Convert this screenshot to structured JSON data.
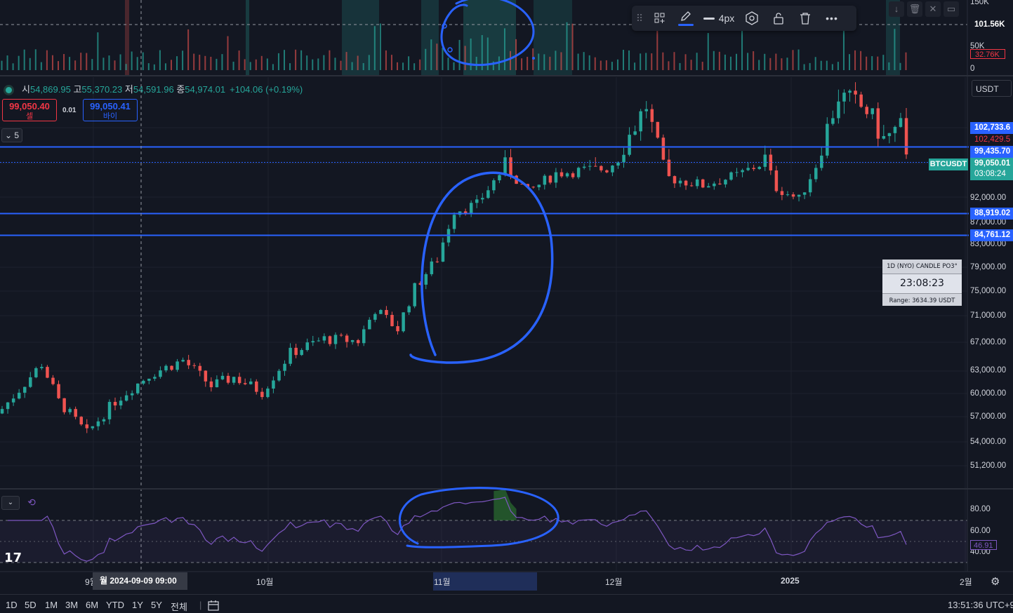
{
  "legend": {
    "open_label": "시",
    "open": "54,869.95",
    "high_label": "고",
    "high": "55,370.23",
    "low_label": "저",
    "low": "54,591.96",
    "close_label": "종",
    "close": "54,974.01",
    "change": "+104.06 (+0.19%)"
  },
  "trade": {
    "sell_price": "99,050.40",
    "sell_label": "셀",
    "spread": "0.01",
    "buy_price": "99,050.41",
    "buy_label": "바이"
  },
  "collapse_count": "5",
  "toolbar": {
    "width_label": "4px"
  },
  "currency": "USDT",
  "volume_axis": {
    "labels": [
      "150K",
      "101.56K",
      "50K",
      "32.76K",
      "0"
    ]
  },
  "price_axis_labels": [
    "92,000.00",
    "87,000.00",
    "83,000.00",
    "79,000.00",
    "75,000.00",
    "71,000.00",
    "67,000.00",
    "63,000.00",
    "60,000.00",
    "57,000.00",
    "54,000.00",
    "51,200.00"
  ],
  "price_tags": {
    "high": "102,733.6",
    "current_red": "102,429.5",
    "line1": "99,435.70",
    "last": "99,050.01",
    "countdown": "03:08:24",
    "line2": "88,919.02",
    "line3": "84,761.12"
  },
  "symbol_tag": "BTCUSDT",
  "timer_card": {
    "title": "1D (NYO) CANDLE PO3°",
    "time": "23:08:23",
    "range": "Range: 3634.39 USDT"
  },
  "rsi": {
    "axis_labels": [
      "80.00",
      "60.00",
      "40.00"
    ],
    "value": "46.91"
  },
  "x_axis": {
    "sep": "9월",
    "crosshair_date": "월 2024-09-09   09:00",
    "oct": "10월",
    "nov": "11월",
    "dec": "12월",
    "y2025": "2025",
    "feb": "2월"
  },
  "bottom_bar": {
    "ranges": [
      "1D",
      "5D",
      "1M",
      "3M",
      "6M",
      "YTD",
      "1Y",
      "5Y",
      "전체"
    ],
    "clock": "13:51:36 UTC+9"
  },
  "colors": {
    "up": "#26a69a",
    "down": "#ef5350",
    "hline": "#2962ff",
    "rsi": "#7e57c2",
    "annotation": "#2962ff"
  },
  "chart_data": {
    "type": "candlestick",
    "symbol": "BTCUSDT",
    "interval": "1D",
    "close_path": [
      [
        "2024-08-25",
        58000
      ],
      [
        "2024-08-28",
        60500
      ],
      [
        "2024-09-01",
        64000
      ],
      [
        "2024-09-04",
        59000
      ],
      [
        "2024-09-07",
        56500
      ],
      [
        "2024-09-09",
        54974
      ],
      [
        "2024-09-14",
        59000
      ],
      [
        "2024-09-20",
        62500
      ],
      [
        "2024-09-26",
        64500
      ],
      [
        "2024-10-01",
        61000
      ],
      [
        "2024-10-05",
        62200
      ],
      [
        "2024-10-10",
        60200
      ],
      [
        "2024-10-15",
        65500
      ],
      [
        "2024-10-21",
        67500
      ],
      [
        "2024-10-27",
        67200
      ],
      [
        "2024-10-30",
        72000
      ],
      [
        "2024-11-03",
        69000
      ],
      [
        "2024-11-06",
        75500
      ],
      [
        "2024-11-10",
        80500
      ],
      [
        "2024-11-13",
        89500
      ],
      [
        "2024-11-17",
        90500
      ],
      [
        "2024-11-22",
        98500
      ],
      [
        "2024-11-26",
        93000
      ],
      [
        "2024-12-01",
        97000
      ],
      [
        "2024-12-05",
        97500
      ],
      [
        "2024-12-10",
        98000
      ],
      [
        "2024-12-17",
        105000
      ],
      [
        "2024-12-21",
        96000
      ],
      [
        "2024-12-27",
        94500
      ],
      [
        "2025-01-02",
        96500
      ],
      [
        "2025-01-07",
        99435
      ],
      [
        "2025-01-09",
        94000
      ],
      [
        "2025-01-13",
        91500
      ],
      [
        "2025-01-17",
        101000
      ],
      [
        "2025-01-20",
        106000
      ],
      [
        "2025-01-25",
        104500
      ],
      [
        "2025-01-28",
        101500
      ],
      [
        "2025-01-31",
        102733
      ],
      [
        "2025-02-01",
        99050
      ]
    ],
    "horizontal_lines": [
      99435.7,
      88919.02,
      84761.12
    ]
  }
}
